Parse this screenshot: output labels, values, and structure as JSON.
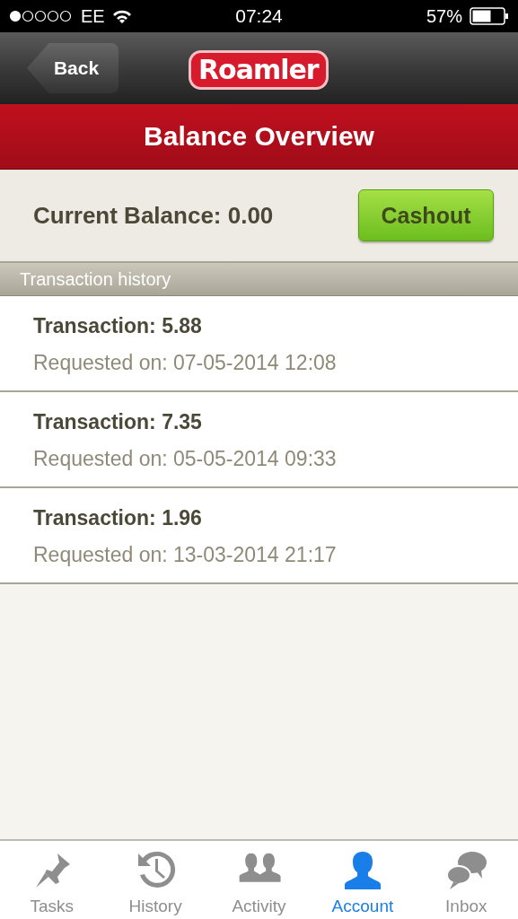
{
  "status_bar": {
    "carrier": "EE",
    "time": "07:24",
    "battery": "57%"
  },
  "nav_bar": {
    "back": "Back",
    "logo": "Roamler"
  },
  "title": "Balance Overview",
  "balance": {
    "label": "Current Balance: 0.00",
    "button": "Cashout"
  },
  "section_header": "Transaction history",
  "transactions": [
    {
      "amount": "Transaction: 5.88",
      "requested": "Requested on: 07-05-2014 12:08"
    },
    {
      "amount": "Transaction: 7.35",
      "requested": "Requested on: 05-05-2014 09:33"
    },
    {
      "amount": "Transaction: 1.96",
      "requested": "Requested on: 13-03-2014 21:17"
    }
  ],
  "tab_bar": [
    {
      "label": "Tasks",
      "selected": false
    },
    {
      "label": "History",
      "selected": false
    },
    {
      "label": "Activity",
      "selected": false
    },
    {
      "label": "Account",
      "selected": true
    },
    {
      "label": "Inbox",
      "selected": false
    }
  ]
}
